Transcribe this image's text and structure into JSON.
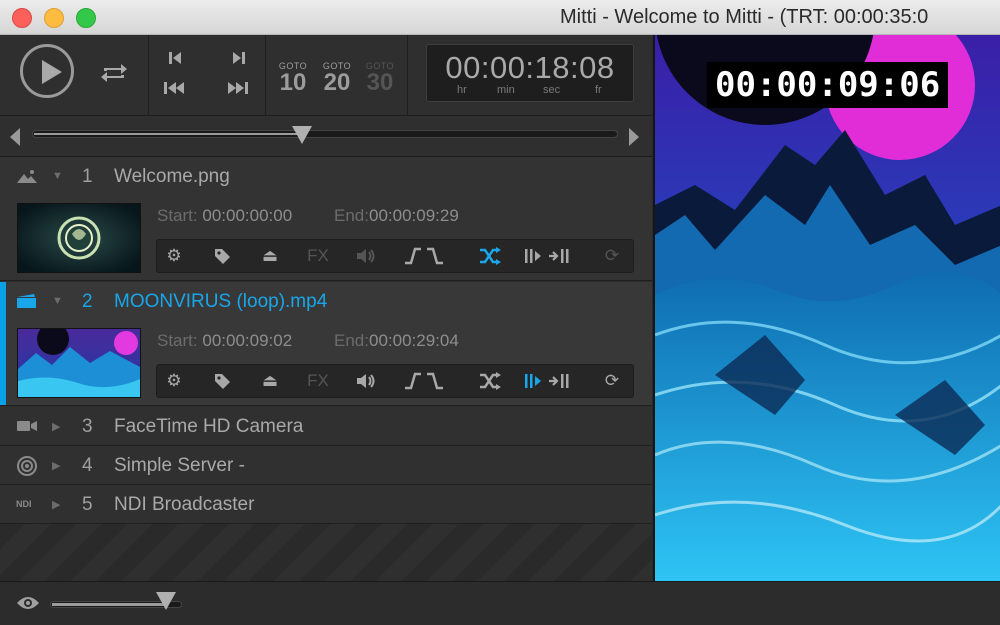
{
  "window": {
    "title": "Mitti - Welcome to Mitti - (TRT: 00:00:35:0"
  },
  "transport": {
    "goto": [
      {
        "label": "GOTO",
        "value": "10",
        "enabled": true
      },
      {
        "label": "GOTO",
        "value": "20",
        "enabled": true
      },
      {
        "label": "GOTO",
        "value": "30",
        "enabled": false
      }
    ],
    "timecode": "00:00:18:08",
    "units": {
      "hr": "hr",
      "min": "min",
      "sec": "sec",
      "fr": "fr"
    }
  },
  "scrubber": {
    "position": 0.46
  },
  "playlist": [
    {
      "index": "1",
      "name": "Welcome.png",
      "icon": "image-icon",
      "expanded": true,
      "active": false,
      "start_label": "Start:",
      "start": "00:00:00:00",
      "end_label": "End:",
      "end": "00:00:09:29"
    },
    {
      "index": "2",
      "name": "MOONVIRUS (loop).mp4",
      "icon": "video-icon",
      "expanded": true,
      "active": true,
      "start_label": "Start:",
      "start": "00:00:09:02",
      "end_label": "End:",
      "end": "00:00:29:04"
    },
    {
      "index": "3",
      "name": "FaceTime HD Camera",
      "icon": "camera-icon",
      "expanded": false
    },
    {
      "index": "4",
      "name": "Simple Server -",
      "icon": "server-icon",
      "expanded": false
    },
    {
      "index": "5",
      "name": "NDI Broadcaster",
      "icon": "ndi-icon",
      "icon_text": "NDI",
      "expanded": false
    }
  ],
  "toolbar_labels": {
    "fx": "FX"
  },
  "volume": {
    "level": 0.88
  },
  "preview": {
    "overlay_timecode": "00:00:09:06"
  },
  "colors": {
    "accent": "#19a6ea"
  }
}
